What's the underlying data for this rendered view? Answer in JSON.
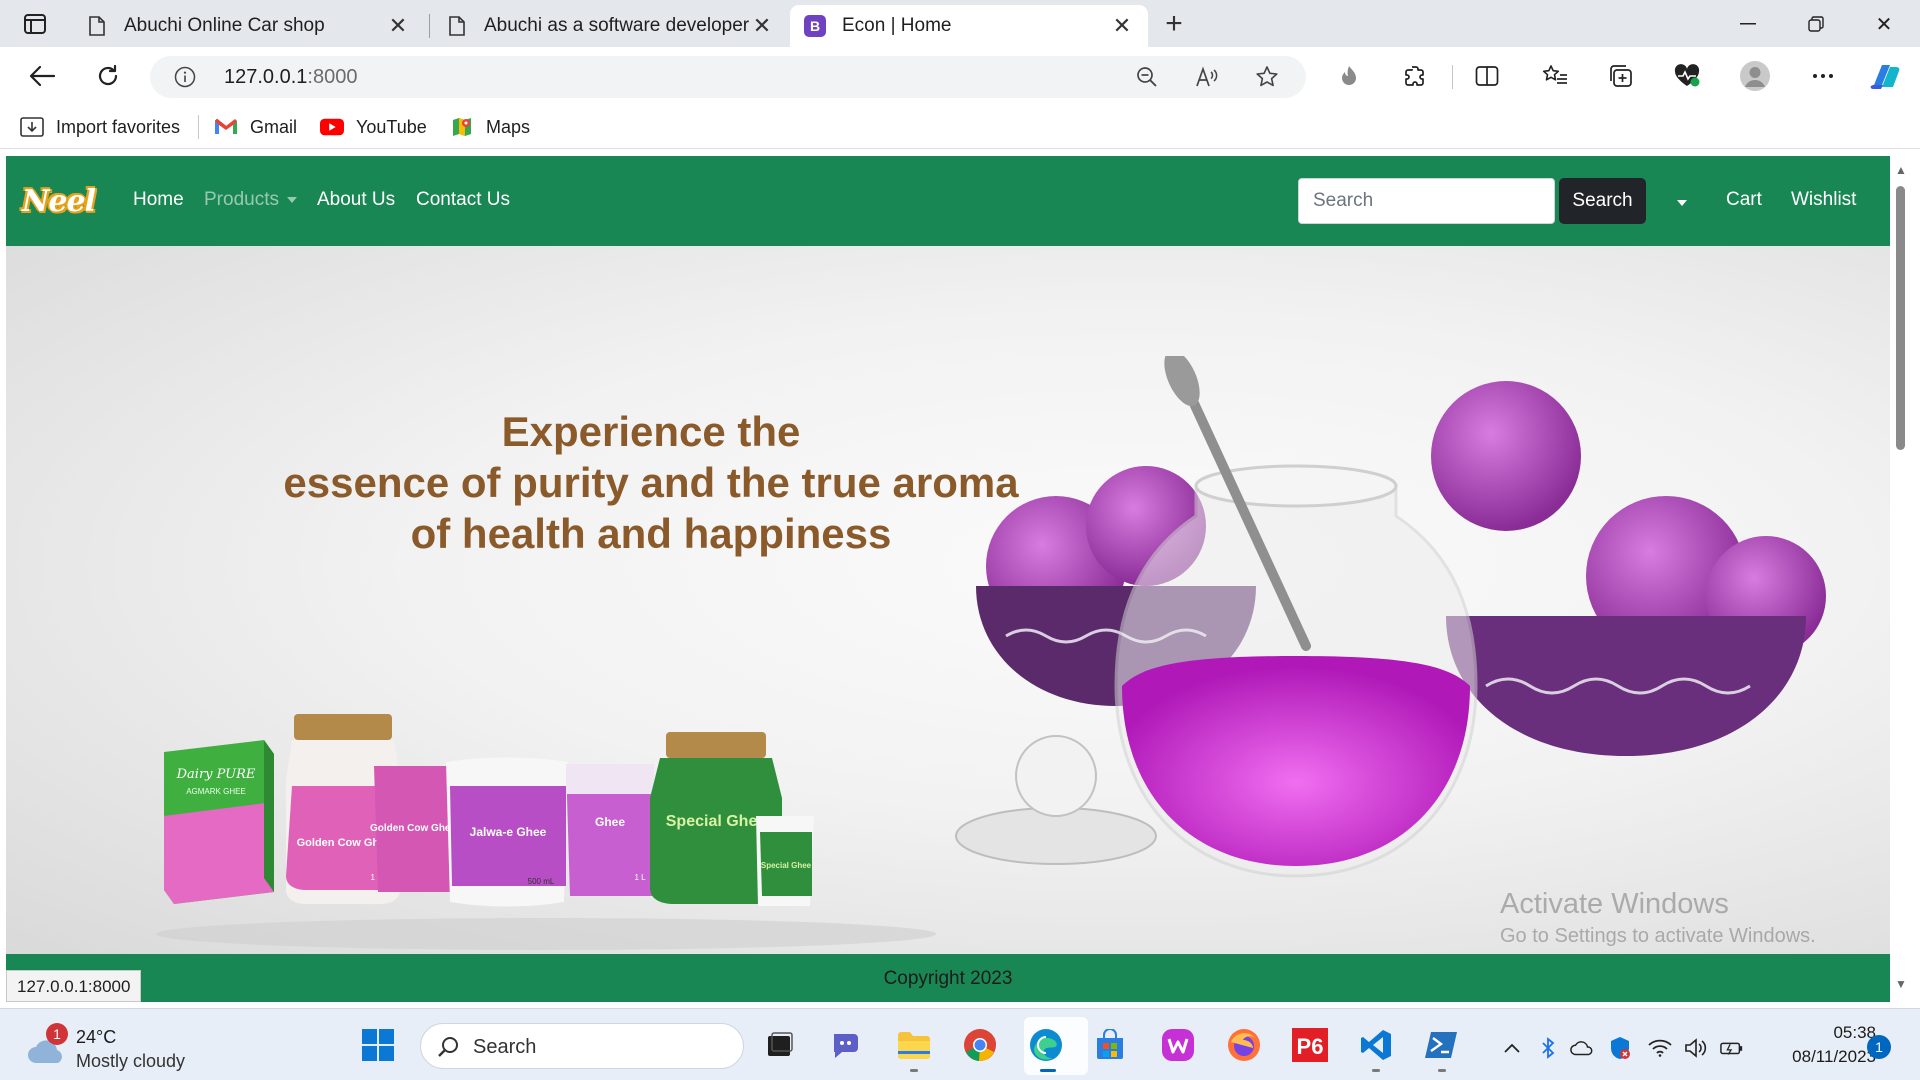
{
  "browser": {
    "tabs": [
      {
        "title": "Abuchi Online Car shop",
        "icon": "page-icon"
      },
      {
        "title": "Abuchi as a software developer",
        "icon": "page-icon"
      },
      {
        "title": "Econ | Home",
        "icon": "bootstrap-icon",
        "favicon_letter": "B",
        "active": true
      }
    ],
    "address": {
      "host": "127.0.0.1",
      "port": ":8000"
    },
    "favorites": [
      {
        "label": "Import favorites",
        "icon": "import-favorites-icon"
      },
      {
        "label": "Gmail",
        "icon": "gmail-icon"
      },
      {
        "label": "YouTube",
        "icon": "youtube-icon"
      },
      {
        "label": "Maps",
        "icon": "maps-icon"
      }
    ],
    "status_url": "127.0.0.1:8000"
  },
  "site": {
    "brand": "Neel",
    "nav": {
      "home": "Home",
      "products": "Products",
      "about": "About Us",
      "contact": "Contact Us",
      "cart": "Cart",
      "wishlist": "Wishlist"
    },
    "search": {
      "placeholder": "Search",
      "button": "Search"
    },
    "hero": {
      "line1": "Experience the",
      "line2": "essence of purity and the true aroma",
      "line3": "of health and happiness",
      "products": [
        {
          "text": "Dairy PURE",
          "sub": "AGMARK GHEE"
        },
        {
          "text": "Golden Cow Ghee",
          "sub": "1 L"
        },
        {
          "text": "Golden Cow Ghee"
        },
        {
          "text": "Jalwa-e Ghee",
          "sub": "500 mL"
        },
        {
          "text": "Ghee",
          "sub": "1 L"
        },
        {
          "text": "Special Ghee"
        },
        {
          "text": "Special Ghee"
        }
      ]
    },
    "footer": "Copyright 2023",
    "watermark": {
      "title": "Activate Windows",
      "subtitle": "Go to Settings to activate Windows."
    },
    "colors": {
      "nav": "#198754",
      "hero_text": "#8a5a2b",
      "ghee_purple": "#c026c8"
    }
  },
  "taskbar": {
    "weather": {
      "temp": "24°C",
      "desc": "Mostly cloudy",
      "badge": "1"
    },
    "search_label": "Search",
    "clock": {
      "time": "05:38",
      "date": "08/11/2023"
    },
    "notification_count": "1"
  }
}
